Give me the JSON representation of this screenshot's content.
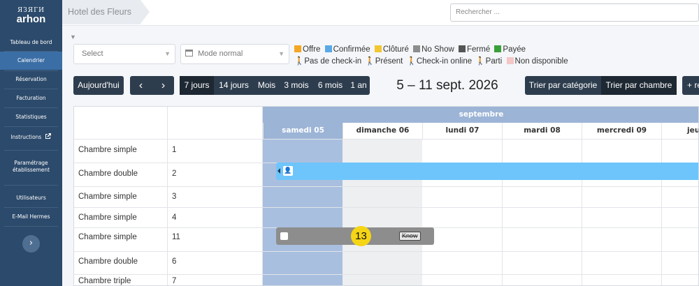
{
  "sidebar": {
    "logo_mark": "ЯЗЯГИ",
    "logo_name": "arhon",
    "items": [
      {
        "label": "Tableau de bord"
      },
      {
        "label": "Calendrier"
      },
      {
        "label": "Réservation"
      },
      {
        "label": "Facturation"
      },
      {
        "label": "Statistiques"
      },
      {
        "label": "Instructions"
      },
      {
        "label": "Paramétrage"
      },
      {
        "label": "établissement"
      },
      {
        "label": "Utilisateurs"
      },
      {
        "label": "E-Mail Hermes"
      }
    ],
    "expand_icon": "›"
  },
  "topbar": {
    "hotel": "Hotel des Fleurs",
    "search_placeholder": "Rechercher ..."
  },
  "filters": {
    "select_placeholder": "Select",
    "mode": "Mode normal"
  },
  "legend": {
    "colors": {
      "offre": "#f5a623",
      "confirmee": "#5aa9e6",
      "cloture": "#f3c632",
      "noshow": "#8d8d8d",
      "ferme": "#555555",
      "payee": "#3aa03a"
    },
    "labels": [
      "Offre",
      "Confirmée",
      "Clôturé",
      "No Show",
      "Fermé",
      "Payée"
    ],
    "status": [
      "Pas de check-in",
      "Présent",
      "Check-in online",
      "Parti",
      "Non disponible"
    ]
  },
  "toolbar": {
    "today": "Aujourd'hui",
    "prev": "‹",
    "next": "›",
    "views": [
      "7 jours",
      "14 jours",
      "Mois",
      "3 mois",
      "6 mois",
      "1 an"
    ],
    "range": "5 – 11 sept. 2026",
    "sort_cat": "Trier par catégorie",
    "sort_room": "Trier par chambre",
    "more": "+ re"
  },
  "calendar": {
    "month": "septembre",
    "days": [
      "samedi 05",
      "dimanche 06",
      "lundi 07",
      "mardi 08",
      "mercredi 09",
      "jeu"
    ],
    "rows": [
      {
        "type": "Chambre simple",
        "room": "1"
      },
      {
        "type": "Chambre double",
        "room": "2"
      },
      {
        "type": "Chambre simple",
        "room": "3"
      },
      {
        "type": "Chambre simple",
        "room": "4"
      },
      {
        "type": "Chambre simple",
        "room": "11"
      },
      {
        "type": "Chambre double",
        "room": "6"
      },
      {
        "type": "Chambre triple",
        "room": "7"
      }
    ],
    "badge": "13",
    "noshow_tag": "Know"
  }
}
